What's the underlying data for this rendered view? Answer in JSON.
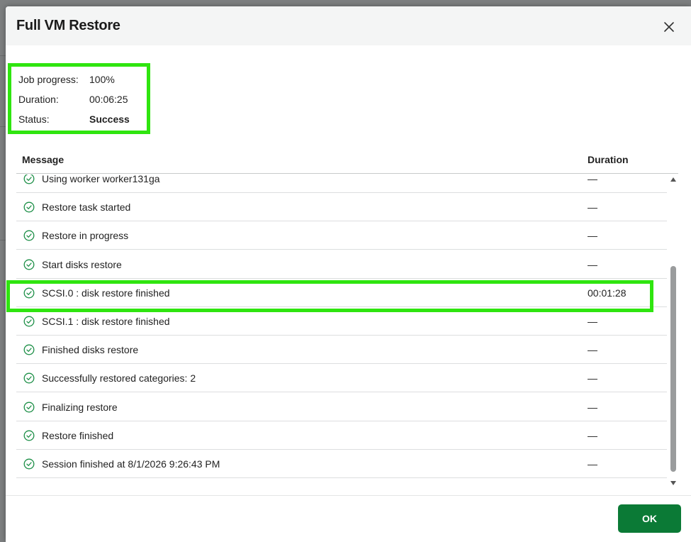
{
  "dialog": {
    "title": "Full VM Restore",
    "close_icon": "close-icon"
  },
  "summary": {
    "job_progress_label": "Job progress:",
    "job_progress_value": "100%",
    "duration_label": "Duration:",
    "duration_value": "00:06:25",
    "status_label": "Status:",
    "status_value": "Success"
  },
  "table": {
    "columns": [
      "Message",
      "Duration"
    ],
    "rows": [
      {
        "message": "Using worker worker131ga",
        "duration": "—"
      },
      {
        "message": "Restore task started",
        "duration": "—"
      },
      {
        "message": "Restore in progress",
        "duration": "—"
      },
      {
        "message": "Start disks restore",
        "duration": "—"
      },
      {
        "message": "SCSI.0 : disk restore finished",
        "duration": "00:01:28"
      },
      {
        "message": "SCSI.1 : disk restore finished",
        "duration": "—"
      },
      {
        "message": "Finished disks restore",
        "duration": "—"
      },
      {
        "message": "Successfully restored categories: 2",
        "duration": "—"
      },
      {
        "message": "Finalizing restore",
        "duration": "—"
      },
      {
        "message": "Restore finished",
        "duration": "—"
      },
      {
        "message": "Session finished at 8/1/2026 9:26:43 PM",
        "duration": "—"
      }
    ]
  },
  "footer": {
    "ok_label": "OK"
  },
  "colors": {
    "accent_green": "#0b7a36",
    "highlight": "#2fe50f",
    "success_icon": "#1d8f47"
  }
}
